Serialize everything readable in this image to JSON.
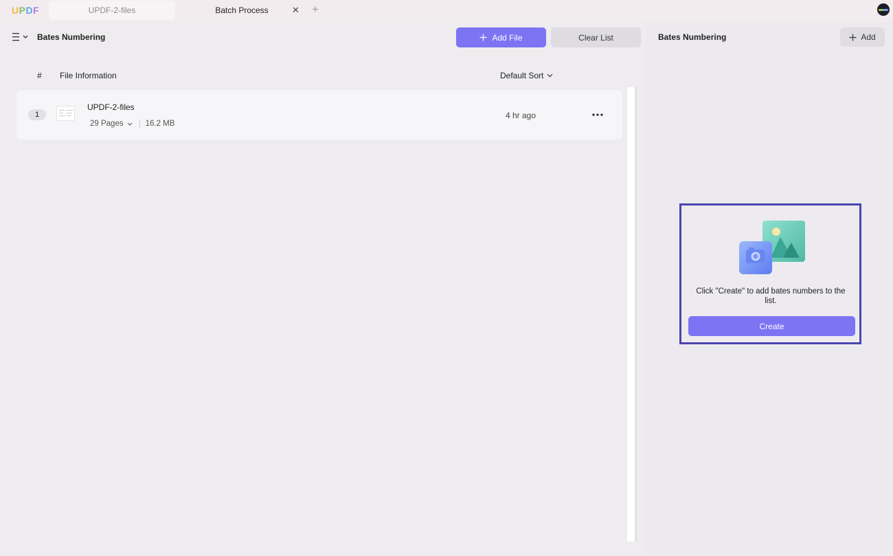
{
  "app": {
    "logo_letters": [
      "U",
      "P",
      "D",
      "F"
    ]
  },
  "tabs": [
    {
      "label": "UPDF-2-files",
      "active": false
    },
    {
      "label": "Batch Process",
      "active": true
    }
  ],
  "tab_close_glyph": "✕",
  "tab_add_glyph": "+",
  "toolbar": {
    "title": "Bates Numbering",
    "add_file_label": "Add File",
    "clear_list_label": "Clear List"
  },
  "list_header": {
    "number": "#",
    "file_info": "File Information",
    "sort": "Default Sort"
  },
  "files": [
    {
      "index": "1",
      "name": "UPDF-2-files",
      "pages": "29 Pages",
      "size": "16.2 MB",
      "time": "4 hr ago"
    }
  ],
  "right_panel": {
    "title": "Bates Numbering",
    "add_label": "Add",
    "empty_message": "Click \"Create\" to add bates numbers to the list.",
    "create_label": "Create"
  },
  "colors": {
    "accent": "#7C74F2",
    "highlight_border": "#4A45B0"
  },
  "icons": [
    "menu-icon",
    "chevron-down-icon",
    "plus-icon",
    "close-icon",
    "file-thumbnail-icon",
    "more-icon",
    "image-placeholder-icon",
    "avatar"
  ]
}
